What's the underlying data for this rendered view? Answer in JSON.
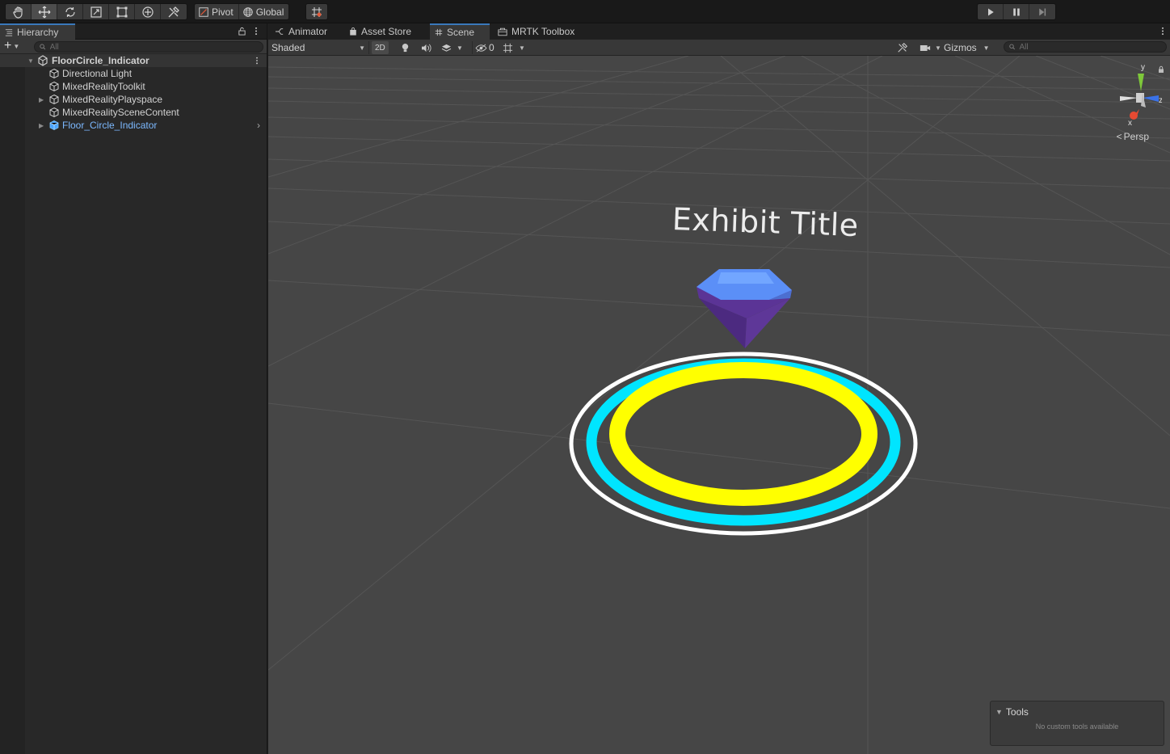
{
  "toolbar": {
    "tools": [
      "hand-tool",
      "move-tool",
      "rotate-tool",
      "scale-tool",
      "rect-tool",
      "transform-tool",
      "custom-tool"
    ],
    "pivot_label": "Pivot",
    "global_label": "Global"
  },
  "hierarchy": {
    "tab_label": "Hierarchy",
    "search_placeholder": "All",
    "items": [
      {
        "label": "FloorCircle_Indicator",
        "kind": "scene"
      },
      {
        "label": "Directional Light",
        "kind": "object"
      },
      {
        "label": "MixedRealityToolkit",
        "kind": "object"
      },
      {
        "label": "MixedRealityPlayspace",
        "kind": "object"
      },
      {
        "label": "MixedRealitySceneContent",
        "kind": "object"
      },
      {
        "label": "Floor_Circle_Indicator",
        "kind": "prefab"
      }
    ]
  },
  "scene_tabs": [
    {
      "label": "Animator"
    },
    {
      "label": "Asset Store"
    },
    {
      "label": "Scene"
    },
    {
      "label": "MRTK Toolbox"
    }
  ],
  "scene_toolbar": {
    "shading_mode": "Shaded",
    "mode_2d": "2D",
    "hidden_count": "0",
    "gizmos_label": "Gizmos",
    "search_placeholder": "All"
  },
  "viewport": {
    "exhibit_title": "Exhibit Title",
    "projection_label": "Persp",
    "axis_labels": {
      "y": "y",
      "z": "z",
      "x": "x"
    }
  },
  "tools_overlay": {
    "title": "Tools",
    "message": "No custom tools available"
  },
  "colors": {
    "ring_outer": "#ffffff",
    "ring_middle": "#00e5ff",
    "ring_inner": "#ffff00",
    "gem_top": "#5b8ff7",
    "gem_bottom": "#5b3496",
    "active_tab": "#3a79bb",
    "prefab_text": "#7cb9ff"
  }
}
